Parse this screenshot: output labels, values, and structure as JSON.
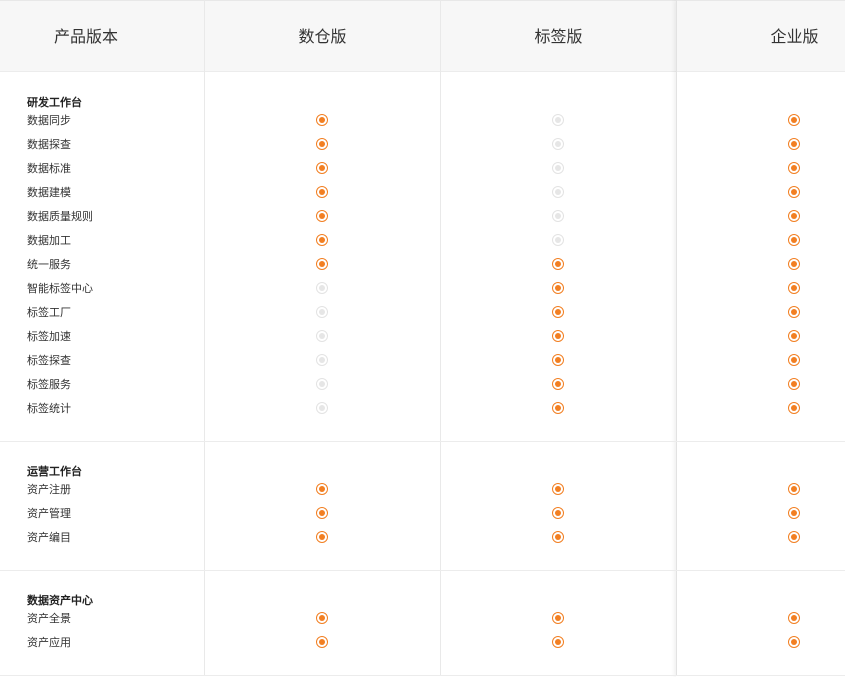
{
  "header": {
    "label": "产品版本",
    "editions": [
      "数仓版",
      "标签版",
      "企业版"
    ]
  },
  "colors": {
    "included": "#f27f22",
    "excluded": "#e6e6e6"
  },
  "groups": [
    {
      "title": "研发工作台",
      "rows": [
        {
          "label": "数据同步",
          "flags": [
            true,
            false,
            true
          ]
        },
        {
          "label": "数据探查",
          "flags": [
            true,
            false,
            true
          ]
        },
        {
          "label": "数据标准",
          "flags": [
            true,
            false,
            true
          ]
        },
        {
          "label": "数据建模",
          "flags": [
            true,
            false,
            true
          ]
        },
        {
          "label": "数据质量规则",
          "flags": [
            true,
            false,
            true
          ]
        },
        {
          "label": "数据加工",
          "flags": [
            true,
            false,
            true
          ]
        },
        {
          "label": "统一服务",
          "flags": [
            true,
            true,
            true
          ]
        },
        {
          "label": "智能标签中心",
          "flags": [
            false,
            true,
            true
          ]
        },
        {
          "label": "标签工厂",
          "flags": [
            false,
            true,
            true
          ]
        },
        {
          "label": "标签加速",
          "flags": [
            false,
            true,
            true
          ]
        },
        {
          "label": "标签探查",
          "flags": [
            false,
            true,
            true
          ]
        },
        {
          "label": "标签服务",
          "flags": [
            false,
            true,
            true
          ]
        },
        {
          "label": "标签统计",
          "flags": [
            false,
            true,
            true
          ]
        }
      ]
    },
    {
      "title": "运营工作台",
      "rows": [
        {
          "label": "资产注册",
          "flags": [
            true,
            true,
            true
          ]
        },
        {
          "label": "资产管理",
          "flags": [
            true,
            true,
            true
          ]
        },
        {
          "label": "资产编目",
          "flags": [
            true,
            true,
            true
          ]
        }
      ]
    },
    {
      "title": "数据资产中心",
      "rows": [
        {
          "label": "资产全景",
          "flags": [
            true,
            true,
            true
          ]
        },
        {
          "label": "资产应用",
          "flags": [
            true,
            true,
            true
          ]
        }
      ]
    }
  ]
}
